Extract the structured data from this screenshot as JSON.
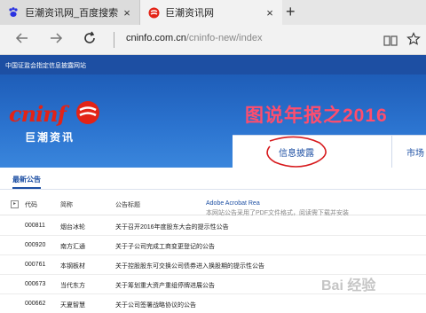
{
  "browser": {
    "tabs": [
      {
        "title": "巨潮资讯网_百度搜索",
        "favicon": "baidu-paw-icon",
        "active": false
      },
      {
        "title": "巨潮资讯网",
        "favicon": "cninfo-icon",
        "active": true
      }
    ],
    "close_glyph": "×",
    "new_tab_glyph": "+",
    "address": {
      "domain": "cninfo.com.cn",
      "path": "/cninfo-new/index"
    }
  },
  "site": {
    "top_strip": "中国证监会指定信息披露网站",
    "logo_en": "cninf",
    "logo_cn": "巨潮资讯",
    "banner_title": "图说年报之2016",
    "nav_tabs": [
      "信息披露",
      "市场"
    ],
    "section_title": "最新公告",
    "table": {
      "columns": [
        "代码",
        "简称",
        "公告标题"
      ],
      "note_prefix": "本网站公告采用了PDF文件格式，阅读需下载并安装",
      "note_link": "Adobe Acrobat Rea",
      "rows": [
        {
          "code": "000811",
          "name": "烟台冰轮",
          "title": "关于召开2016年度股东大会的提示性公告"
        },
        {
          "code": "000920",
          "name": "南方汇通",
          "title": "关于子公司完成工商变更登记的公告"
        },
        {
          "code": "000761",
          "name": "本钢板材",
          "title": "关于控股股东可交换公司债券进入换股期的提示性公告"
        },
        {
          "code": "000673",
          "name": "当代东方",
          "title": "关于筹划重大资产重组停牌进展公告"
        },
        {
          "code": "000662",
          "name": "天夏智慧",
          "title": "关于公司签署战略协议的公告"
        }
      ]
    }
  },
  "watermark": "Bai 经验",
  "colors": {
    "brand_blue": "#1d4fa3",
    "logo_red": "#e32316",
    "banner_title": "#ff4d6d",
    "annotation_red": "#d7191c"
  }
}
